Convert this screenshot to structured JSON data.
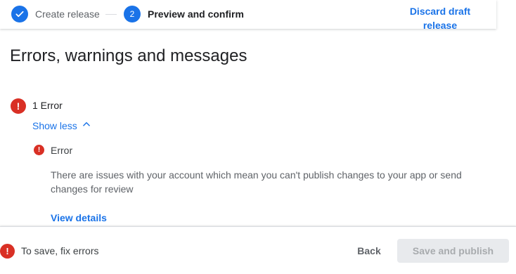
{
  "stepper": {
    "steps": [
      {
        "label": "Create release",
        "state": "complete",
        "icon": "check-icon"
      },
      {
        "number": "2",
        "label": "Preview and confirm",
        "state": "current"
      }
    ],
    "discard_label": "Discard draft release"
  },
  "page_title": "Errors, warnings and messages",
  "summary": {
    "error_count_label": "1 Error",
    "toggle_label": "Show less",
    "toggle_icon": "chevron-up-icon"
  },
  "error_item": {
    "title": "Error",
    "description": "There are issues with your account which mean you can't publish changes to your app or send changes for review",
    "link_label": "View details"
  },
  "footer": {
    "message": "To save, fix errors",
    "back_label": "Back",
    "publish_label": "Save and publish"
  },
  "colors": {
    "accent": "#1a73e8",
    "error": "#d93025",
    "disabled_bg": "#e8eaed"
  }
}
